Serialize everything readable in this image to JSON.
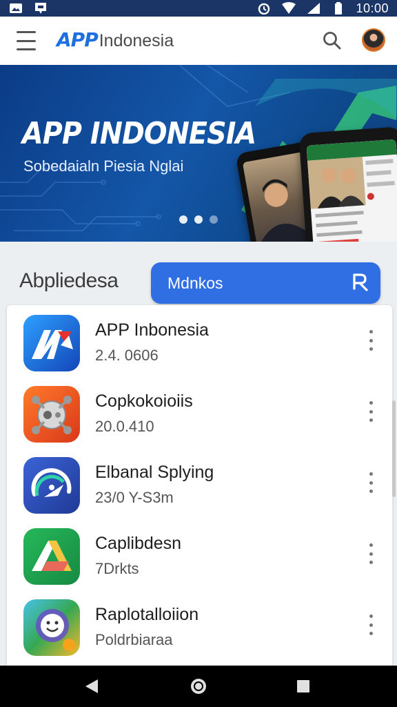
{
  "status_bar": {
    "time": "10:00",
    "icons_left": [
      "image-icon",
      "notification-icon"
    ],
    "icons_right": [
      "alarm-icon",
      "wifi-icon",
      "signal-icon",
      "battery-icon"
    ]
  },
  "app_bar": {
    "logo_app": "APP",
    "logo_name": "Indonesia",
    "menu_icon": "hamburger-menu-icon",
    "search_icon": "search-icon",
    "avatar": "user-avatar"
  },
  "banner": {
    "title": "APP INDONESIA",
    "subtitle": "Sobedaialn Piesia Nglai",
    "carousel_total": 3,
    "carousel_active": 1
  },
  "section": {
    "title": "Abpliedesa",
    "search_label": "Mdnkos",
    "search_icon": "search-r-icon"
  },
  "apps": [
    {
      "name": "APP Inbonesia",
      "sub": "2.4. 0606",
      "icon": "app-indonesia-icon",
      "color": "#1e6fe0"
    },
    {
      "name": "Copkokoioiis",
      "sub": "20.0.410",
      "icon": "robot-icon",
      "color": "#e8531c"
    },
    {
      "name": "Elbanal Splying",
      "sub": "23/0 Y-S3m",
      "icon": "speedometer-icon",
      "color": "#2f4fb5"
    },
    {
      "name": "Caplibdesn",
      "sub": "7Drkts",
      "icon": "drive-triangle-icon",
      "color": "#1e9e4b"
    },
    {
      "name": "Raplotalloiion",
      "sub": "Poldrbiaraa",
      "icon": "smiley-camera-icon",
      "color": "#3aa3d8"
    }
  ],
  "nav_bar": {
    "back_icon": "back-triangle-icon",
    "home_icon": "home-circle-icon",
    "recents_icon": "recents-square-icon"
  }
}
